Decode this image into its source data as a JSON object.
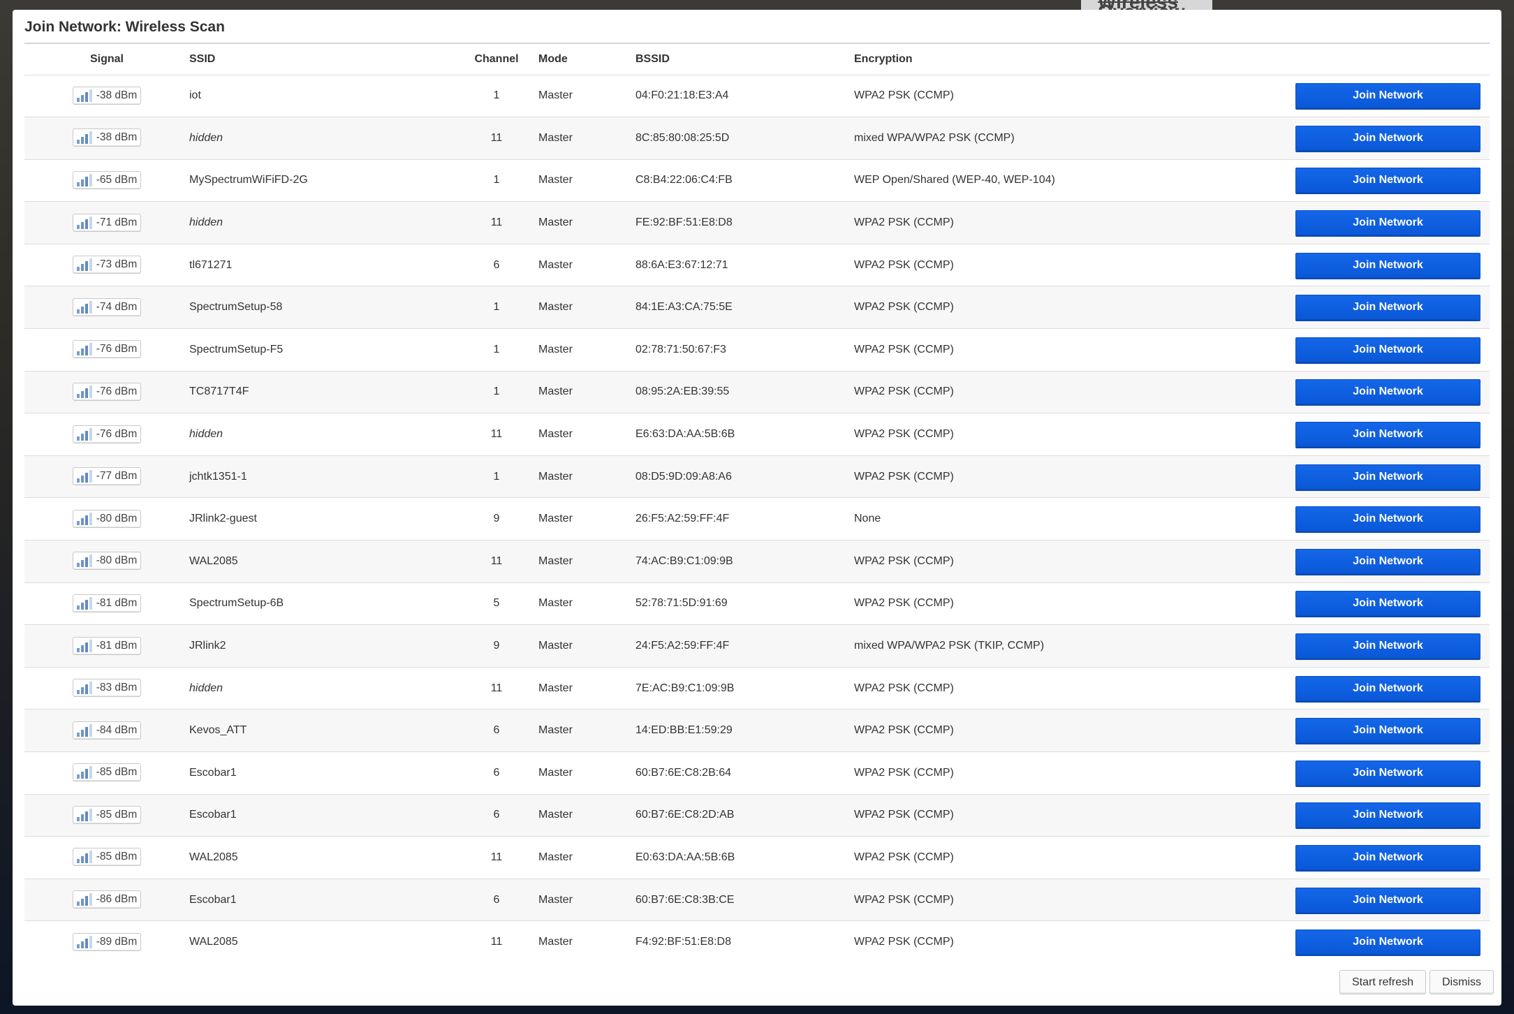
{
  "background_title": "Wireless Overview",
  "modal": {
    "title": "Join Network: Wireless Scan",
    "columns": [
      "Signal",
      "SSID",
      "Channel",
      "Mode",
      "BSSID",
      "Encryption"
    ],
    "join_label": "Join Network",
    "footer": {
      "refresh_label": "Start refresh",
      "dismiss_label": "Dismiss"
    }
  },
  "networks": [
    {
      "signal": "-38 dBm",
      "ssid": "iot",
      "hidden": false,
      "channel": "1",
      "mode": "Master",
      "bssid": "04:F0:21:18:E3:A4",
      "encryption": "WPA2 PSK (CCMP)"
    },
    {
      "signal": "-38 dBm",
      "ssid": "hidden",
      "hidden": true,
      "channel": "11",
      "mode": "Master",
      "bssid": "8C:85:80:08:25:5D",
      "encryption": "mixed WPA/WPA2 PSK (CCMP)"
    },
    {
      "signal": "-65 dBm",
      "ssid": "MySpectrumWiFiFD-2G",
      "hidden": false,
      "channel": "1",
      "mode": "Master",
      "bssid": "C8:B4:22:06:C4:FB",
      "encryption": "WEP Open/Shared (WEP-40, WEP-104)"
    },
    {
      "signal": "-71 dBm",
      "ssid": "hidden",
      "hidden": true,
      "channel": "11",
      "mode": "Master",
      "bssid": "FE:92:BF:51:E8:D8",
      "encryption": "WPA2 PSK (CCMP)"
    },
    {
      "signal": "-73 dBm",
      "ssid": "tl671271",
      "hidden": false,
      "channel": "6",
      "mode": "Master",
      "bssid": "88:6A:E3:67:12:71",
      "encryption": "WPA2 PSK (CCMP)"
    },
    {
      "signal": "-74 dBm",
      "ssid": "SpectrumSetup-58",
      "hidden": false,
      "channel": "1",
      "mode": "Master",
      "bssid": "84:1E:A3:CA:75:5E",
      "encryption": "WPA2 PSK (CCMP)"
    },
    {
      "signal": "-76 dBm",
      "ssid": "SpectrumSetup-F5",
      "hidden": false,
      "channel": "1",
      "mode": "Master",
      "bssid": "02:78:71:50:67:F3",
      "encryption": "WPA2 PSK (CCMP)"
    },
    {
      "signal": "-76 dBm",
      "ssid": "TC8717T4F",
      "hidden": false,
      "channel": "1",
      "mode": "Master",
      "bssid": "08:95:2A:EB:39:55",
      "encryption": "WPA2 PSK (CCMP)"
    },
    {
      "signal": "-76 dBm",
      "ssid": "hidden",
      "hidden": true,
      "channel": "11",
      "mode": "Master",
      "bssid": "E6:63:DA:AA:5B:6B",
      "encryption": "WPA2 PSK (CCMP)"
    },
    {
      "signal": "-77 dBm",
      "ssid": "jchtk1351-1",
      "hidden": false,
      "channel": "1",
      "mode": "Master",
      "bssid": "08:D5:9D:09:A8:A6",
      "encryption": "WPA2 PSK (CCMP)"
    },
    {
      "signal": "-80 dBm",
      "ssid": "JRlink2-guest",
      "hidden": false,
      "channel": "9",
      "mode": "Master",
      "bssid": "26:F5:A2:59:FF:4F",
      "encryption": "None"
    },
    {
      "signal": "-80 dBm",
      "ssid": "WAL2085",
      "hidden": false,
      "channel": "11",
      "mode": "Master",
      "bssid": "74:AC:B9:C1:09:9B",
      "encryption": "WPA2 PSK (CCMP)"
    },
    {
      "signal": "-81 dBm",
      "ssid": "SpectrumSetup-6B",
      "hidden": false,
      "channel": "5",
      "mode": "Master",
      "bssid": "52:78:71:5D:91:69",
      "encryption": "WPA2 PSK (CCMP)"
    },
    {
      "signal": "-81 dBm",
      "ssid": "JRlink2",
      "hidden": false,
      "channel": "9",
      "mode": "Master",
      "bssid": "24:F5:A2:59:FF:4F",
      "encryption": "mixed WPA/WPA2 PSK (TKIP, CCMP)"
    },
    {
      "signal": "-83 dBm",
      "ssid": "hidden",
      "hidden": true,
      "channel": "11",
      "mode": "Master",
      "bssid": "7E:AC:B9:C1:09:9B",
      "encryption": "WPA2 PSK (CCMP)"
    },
    {
      "signal": "-84 dBm",
      "ssid": "Kevos_ATT",
      "hidden": false,
      "channel": "6",
      "mode": "Master",
      "bssid": "14:ED:BB:E1:59:29",
      "encryption": "WPA2 PSK (CCMP)"
    },
    {
      "signal": "-85 dBm",
      "ssid": "Escobar1",
      "hidden": false,
      "channel": "6",
      "mode": "Master",
      "bssid": "60:B7:6E:C8:2B:64",
      "encryption": "WPA2 PSK (CCMP)"
    },
    {
      "signal": "-85 dBm",
      "ssid": "Escobar1",
      "hidden": false,
      "channel": "6",
      "mode": "Master",
      "bssid": "60:B7:6E:C8:2D:AB",
      "encryption": "WPA2 PSK (CCMP)"
    },
    {
      "signal": "-85 dBm",
      "ssid": "WAL2085",
      "hidden": false,
      "channel": "11",
      "mode": "Master",
      "bssid": "E0:63:DA:AA:5B:6B",
      "encryption": "WPA2 PSK (CCMP)"
    },
    {
      "signal": "-86 dBm",
      "ssid": "Escobar1",
      "hidden": false,
      "channel": "6",
      "mode": "Master",
      "bssid": "60:B7:6E:C8:3B:CE",
      "encryption": "WPA2 PSK (CCMP)"
    },
    {
      "signal": "-89 dBm",
      "ssid": "WAL2085",
      "hidden": false,
      "channel": "11",
      "mode": "Master",
      "bssid": "F4:92:BF:51:E8:D8",
      "encryption": "WPA2 PSK (CCMP)"
    }
  ]
}
